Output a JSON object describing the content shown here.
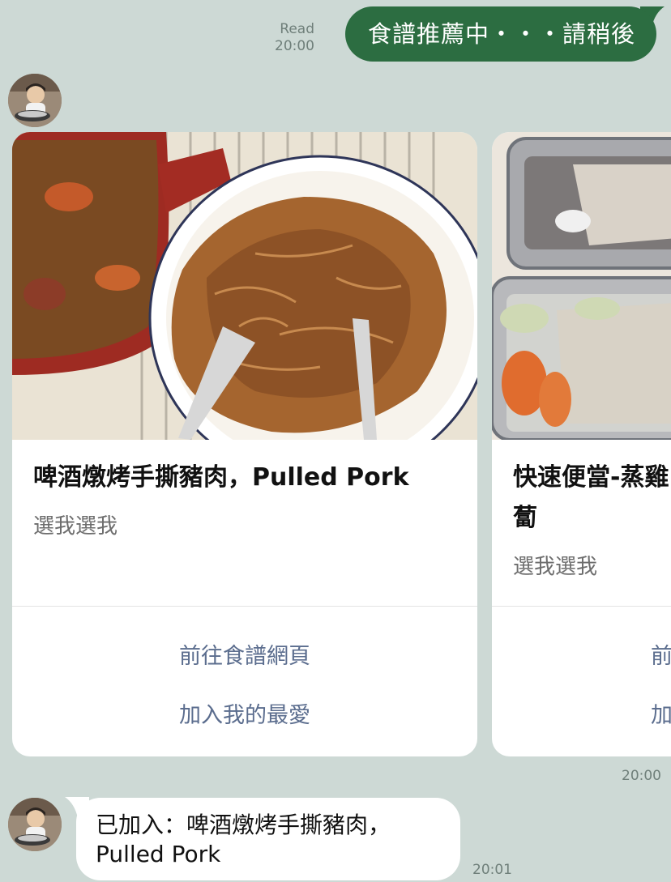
{
  "outgoing": {
    "read_label": "Read",
    "time": "20:00",
    "text": "食譜推薦中・・・請稍後"
  },
  "carousel": {
    "cards": [
      {
        "title": "啤酒燉烤手撕豬肉，Pulled Pork",
        "subtitle": "選我選我",
        "actions": [
          "前往食譜網頁",
          "加入我的最愛"
        ]
      },
      {
        "title": "快速便當-蒸雞\n蔔",
        "subtitle": "選我選我",
        "actions": [
          "前",
          "加"
        ]
      }
    ],
    "time": "20:00"
  },
  "incoming": {
    "text": "已加入：啤酒燉烤手撕豬肉，\nPulled Pork",
    "time": "20:01"
  },
  "colors": {
    "chat_background": "#cdd9d5",
    "outgoing_bubble": "#2c6d41",
    "action_link": "#5b6d8e"
  }
}
